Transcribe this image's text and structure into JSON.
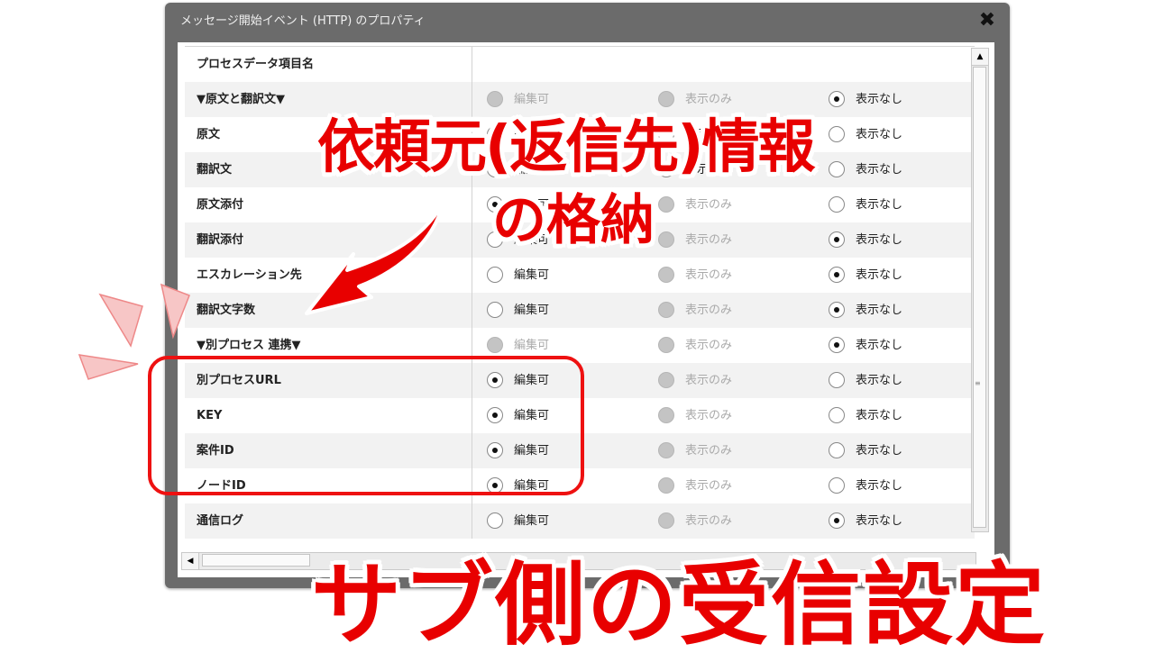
{
  "dialog": {
    "title": "メッセージ開始イベント (HTTP) のプロパティ",
    "close_symbol": "✖"
  },
  "table": {
    "header": "プロセスデータ項目名",
    "options": [
      "編集可",
      "表示のみ",
      "表示なし"
    ],
    "rows": [
      {
        "name": "▼原文と翻訳文▼",
        "selected": 3,
        "disabled": [
          1,
          2
        ]
      },
      {
        "name": "原文",
        "selected": 0,
        "disabled": []
      },
      {
        "name": "翻訳文",
        "selected": 0,
        "disabled": []
      },
      {
        "name": "原文添付",
        "selected": 1,
        "disabled": [
          2
        ]
      },
      {
        "name": "翻訳添付",
        "selected": 3,
        "disabled": [
          2
        ]
      },
      {
        "name": "エスカレーション先",
        "selected": 3,
        "disabled": [
          2
        ]
      },
      {
        "name": "翻訳文字数",
        "selected": 3,
        "disabled": [
          2
        ]
      },
      {
        "name": "▼別プロセス 連携▼",
        "selected": 3,
        "disabled": [
          1,
          2
        ]
      },
      {
        "name": "別プロセスURL",
        "selected": 1,
        "disabled": [
          2
        ]
      },
      {
        "name": "KEY",
        "selected": 1,
        "disabled": [
          2
        ]
      },
      {
        "name": "案件ID",
        "selected": 1,
        "disabled": [
          2
        ]
      },
      {
        "name": "ノードID",
        "selected": 1,
        "disabled": [
          2
        ]
      },
      {
        "name": "通信ログ",
        "selected": 3,
        "disabled": [
          2
        ]
      }
    ]
  },
  "annotations": {
    "callout_line1": "依頼元(返信先)情報",
    "callout_line2": "の格納",
    "bottom_title": "サブ側の受信設定"
  },
  "colors": {
    "accent_red": "#e80000",
    "dialog_frame": "#6b6b6b"
  }
}
